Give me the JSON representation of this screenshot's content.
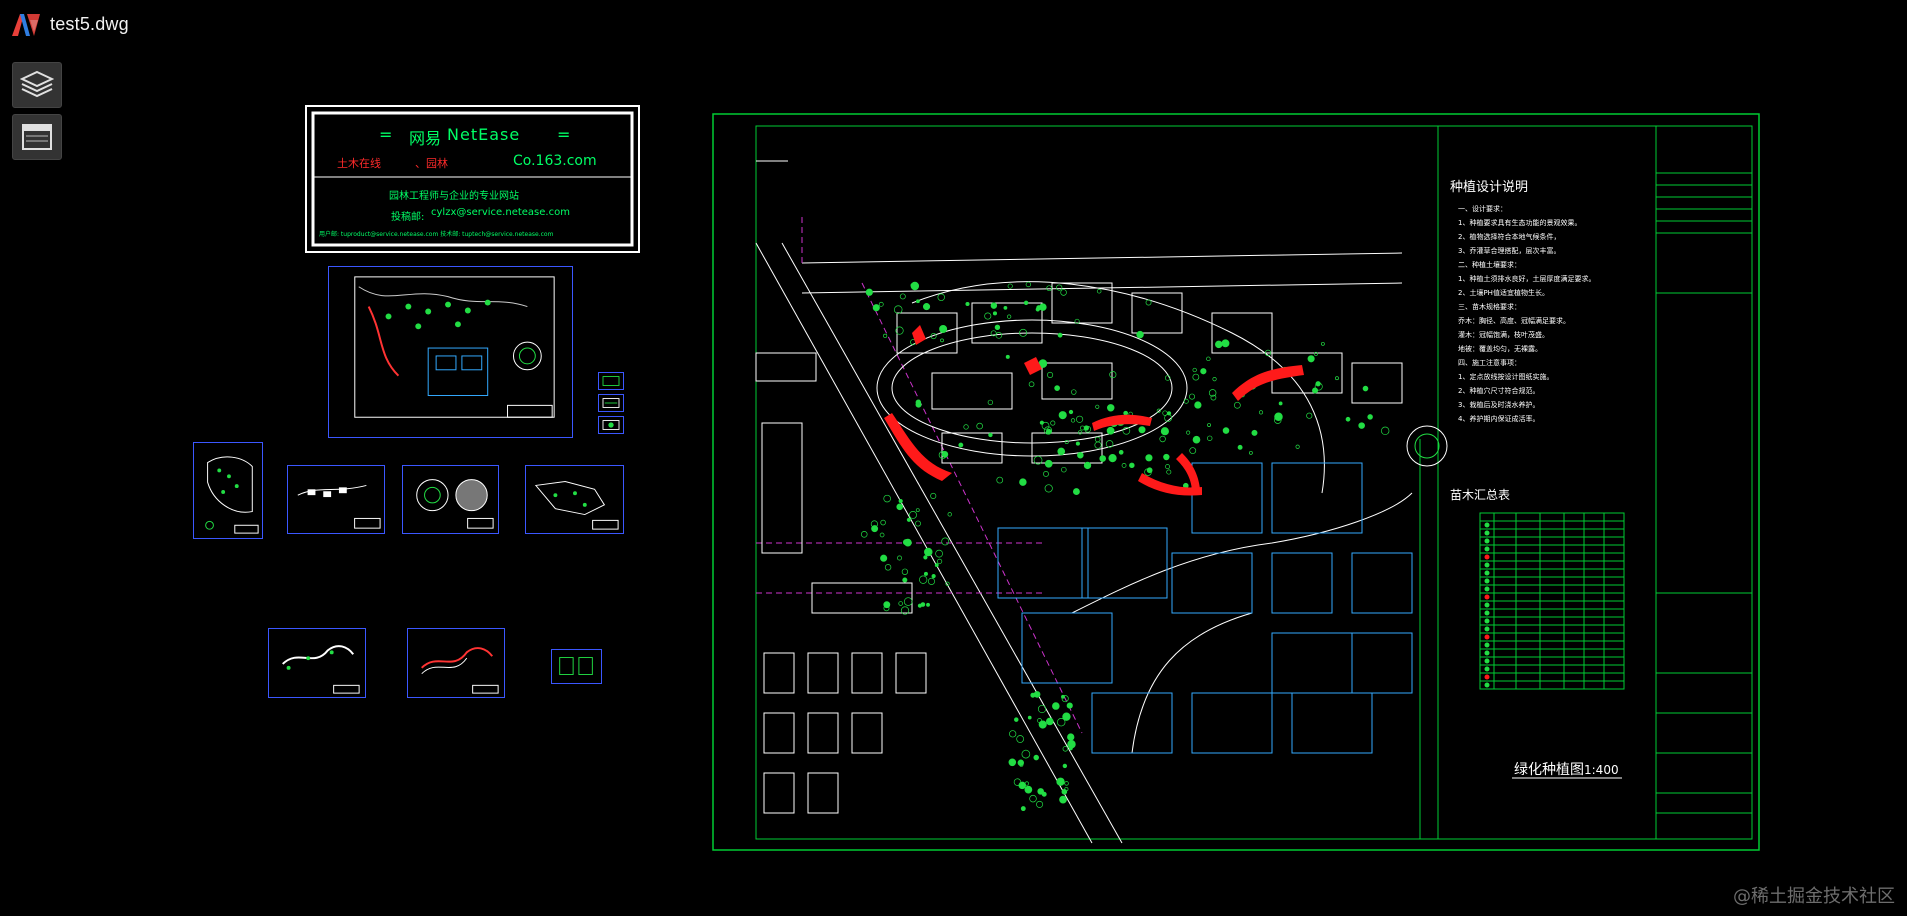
{
  "app": {
    "file_name": "test5.dwg",
    "logo_icon": "app-logo-icon"
  },
  "toolbar": {
    "layers_icon": "layers-icon",
    "layout_icon": "layout-window-icon"
  },
  "netease_card": {
    "title_cn": "网易",
    "title_en": "NetEase",
    "title_eq": "=",
    "row2_left": "土木在线",
    "row2_mid": "、园林",
    "row2_right": "Co.163.com",
    "slogan": "园林工程师与企业的专业网站",
    "contact_label": "投稿邮:",
    "contact_email": "cylzx@service.netease.com",
    "footer": "用户邮: tuproduct@service.netease.com   技术邮: tuptech@service.netease.com",
    "colors": {
      "frame": "#ffffff",
      "title": "#00ff66",
      "red": "#ff2a2a",
      "cyan": "#33ddff"
    }
  },
  "main_plan": {
    "title_block_heading": "种植设计说明",
    "notes": [
      "一、设计要求：",
      "1、种植要求具有生态功能的景观效果。",
      "2、植物选择符合本地气候条件，",
      "3、乔灌草合理搭配，层次丰富。",
      "二、种植土壤要求：",
      "1、种植土须排水良好，土层厚度满足要求。",
      "2、土壤PH值适宜植物生长。",
      "三、苗木规格要求：",
      "乔木：胸径、高度、冠幅满足要求。",
      "灌木：冠幅饱满，枝叶茂盛。",
      "地被：覆盖均匀，无裸露。",
      "四、施工注意事项：",
      "1、定点放线按设计图纸实施。",
      "2、种植穴尺寸符合规范。",
      "3、栽植后及时浇水养护。",
      "4、养护期内保证成活率。"
    ],
    "legend_heading": "苗木汇总表",
    "drawing_title": "绿化种植图",
    "scale": "1:400",
    "colors": {
      "frame": "#00cc33",
      "red": "#ff1a1a",
      "tree": "#22dd44",
      "building": "#33aaff",
      "road": "#ffffff",
      "boundary": "#cc33cc",
      "text": "#ffffff"
    }
  },
  "watermark": "@稀土掘金技术社区"
}
